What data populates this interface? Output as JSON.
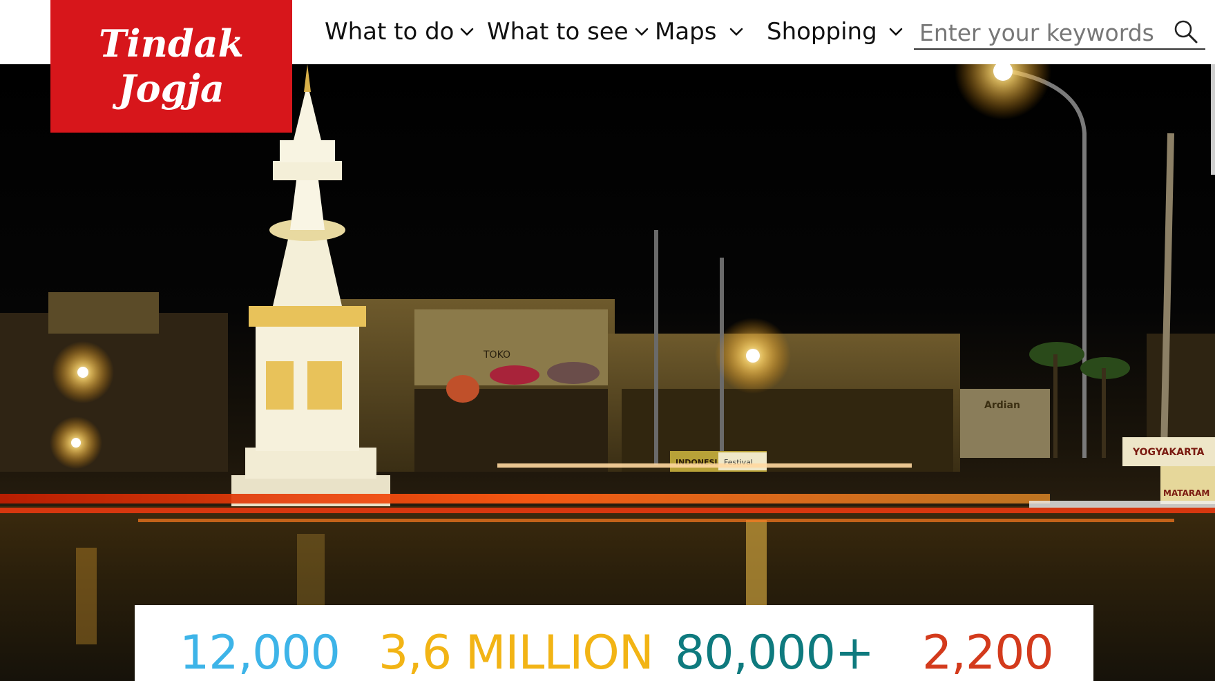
{
  "brand": {
    "line1": "Tindak",
    "line2": "Jogja",
    "color": "#d7161b"
  },
  "nav": {
    "items": [
      {
        "label": "What to do",
        "icon": "chevron-down-icon"
      },
      {
        "label": "What to see",
        "icon": "chevron-down-icon"
      },
      {
        "label": "Maps",
        "icon": "chevron-down-icon"
      },
      {
        "label": "Shopping",
        "icon": "chevron-down-icon"
      }
    ]
  },
  "search": {
    "placeholder": "Enter your keywords",
    "value": "",
    "icon": "search-icon"
  },
  "hero": {
    "sign_toko": "TOKO",
    "sign_ardian": "Ardian",
    "sign_yogyakarta": "YOGYAKARTA",
    "sign_mataram": "MATARAM",
    "sign_festival": "Festival",
    "sign_indonesia": "INDONESIA"
  },
  "stats": {
    "items": [
      {
        "value": "12,000",
        "color": "#3db4e8"
      },
      {
        "value": "3,6 MILLION",
        "color": "#f2b415"
      },
      {
        "value": "80,000+",
        "color": "#0e7a7e"
      },
      {
        "value": "2,200",
        "color": "#d33a1c"
      }
    ]
  }
}
